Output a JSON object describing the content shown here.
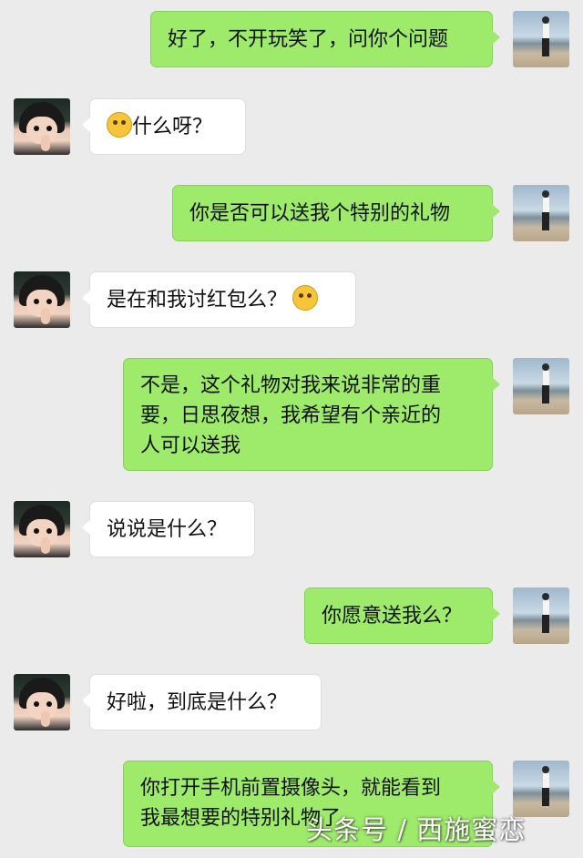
{
  "messages": [
    {
      "side": "me",
      "lines": [
        "好了，不开玩笑了，问你个问题"
      ]
    },
    {
      "side": "her",
      "lines": [
        "什么呀？"
      ],
      "emoji": "dizzy-face-icon",
      "emoji_position": "before"
    },
    {
      "side": "me",
      "lines": [
        "你是否可以送我个特别的礼物"
      ]
    },
    {
      "side": "her",
      "lines": [
        "是在和我讨红包么？"
      ],
      "emoji": "thinking-face-icon",
      "emoji_position": "after"
    },
    {
      "side": "me",
      "lines": [
        "不是，这个礼物对我来说非常的重",
        "要，日思夜想，我希望有个亲近的",
        "人可以送我"
      ]
    },
    {
      "side": "her",
      "lines": [
        "说说是什么？"
      ]
    },
    {
      "side": "me",
      "lines": [
        "你愿意送我么？"
      ]
    },
    {
      "side": "her",
      "lines": [
        "好啦，到底是什么？"
      ]
    },
    {
      "side": "me",
      "lines": [
        "你打开手机前置摄像头，就能看到",
        "我最想要的特别礼物了"
      ]
    }
  ],
  "watermark": "头条号 / 西施蜜恋",
  "colors": {
    "me_bubble": "#9eea6a",
    "her_bubble": "#ffffff",
    "background": "#ebebeb"
  }
}
